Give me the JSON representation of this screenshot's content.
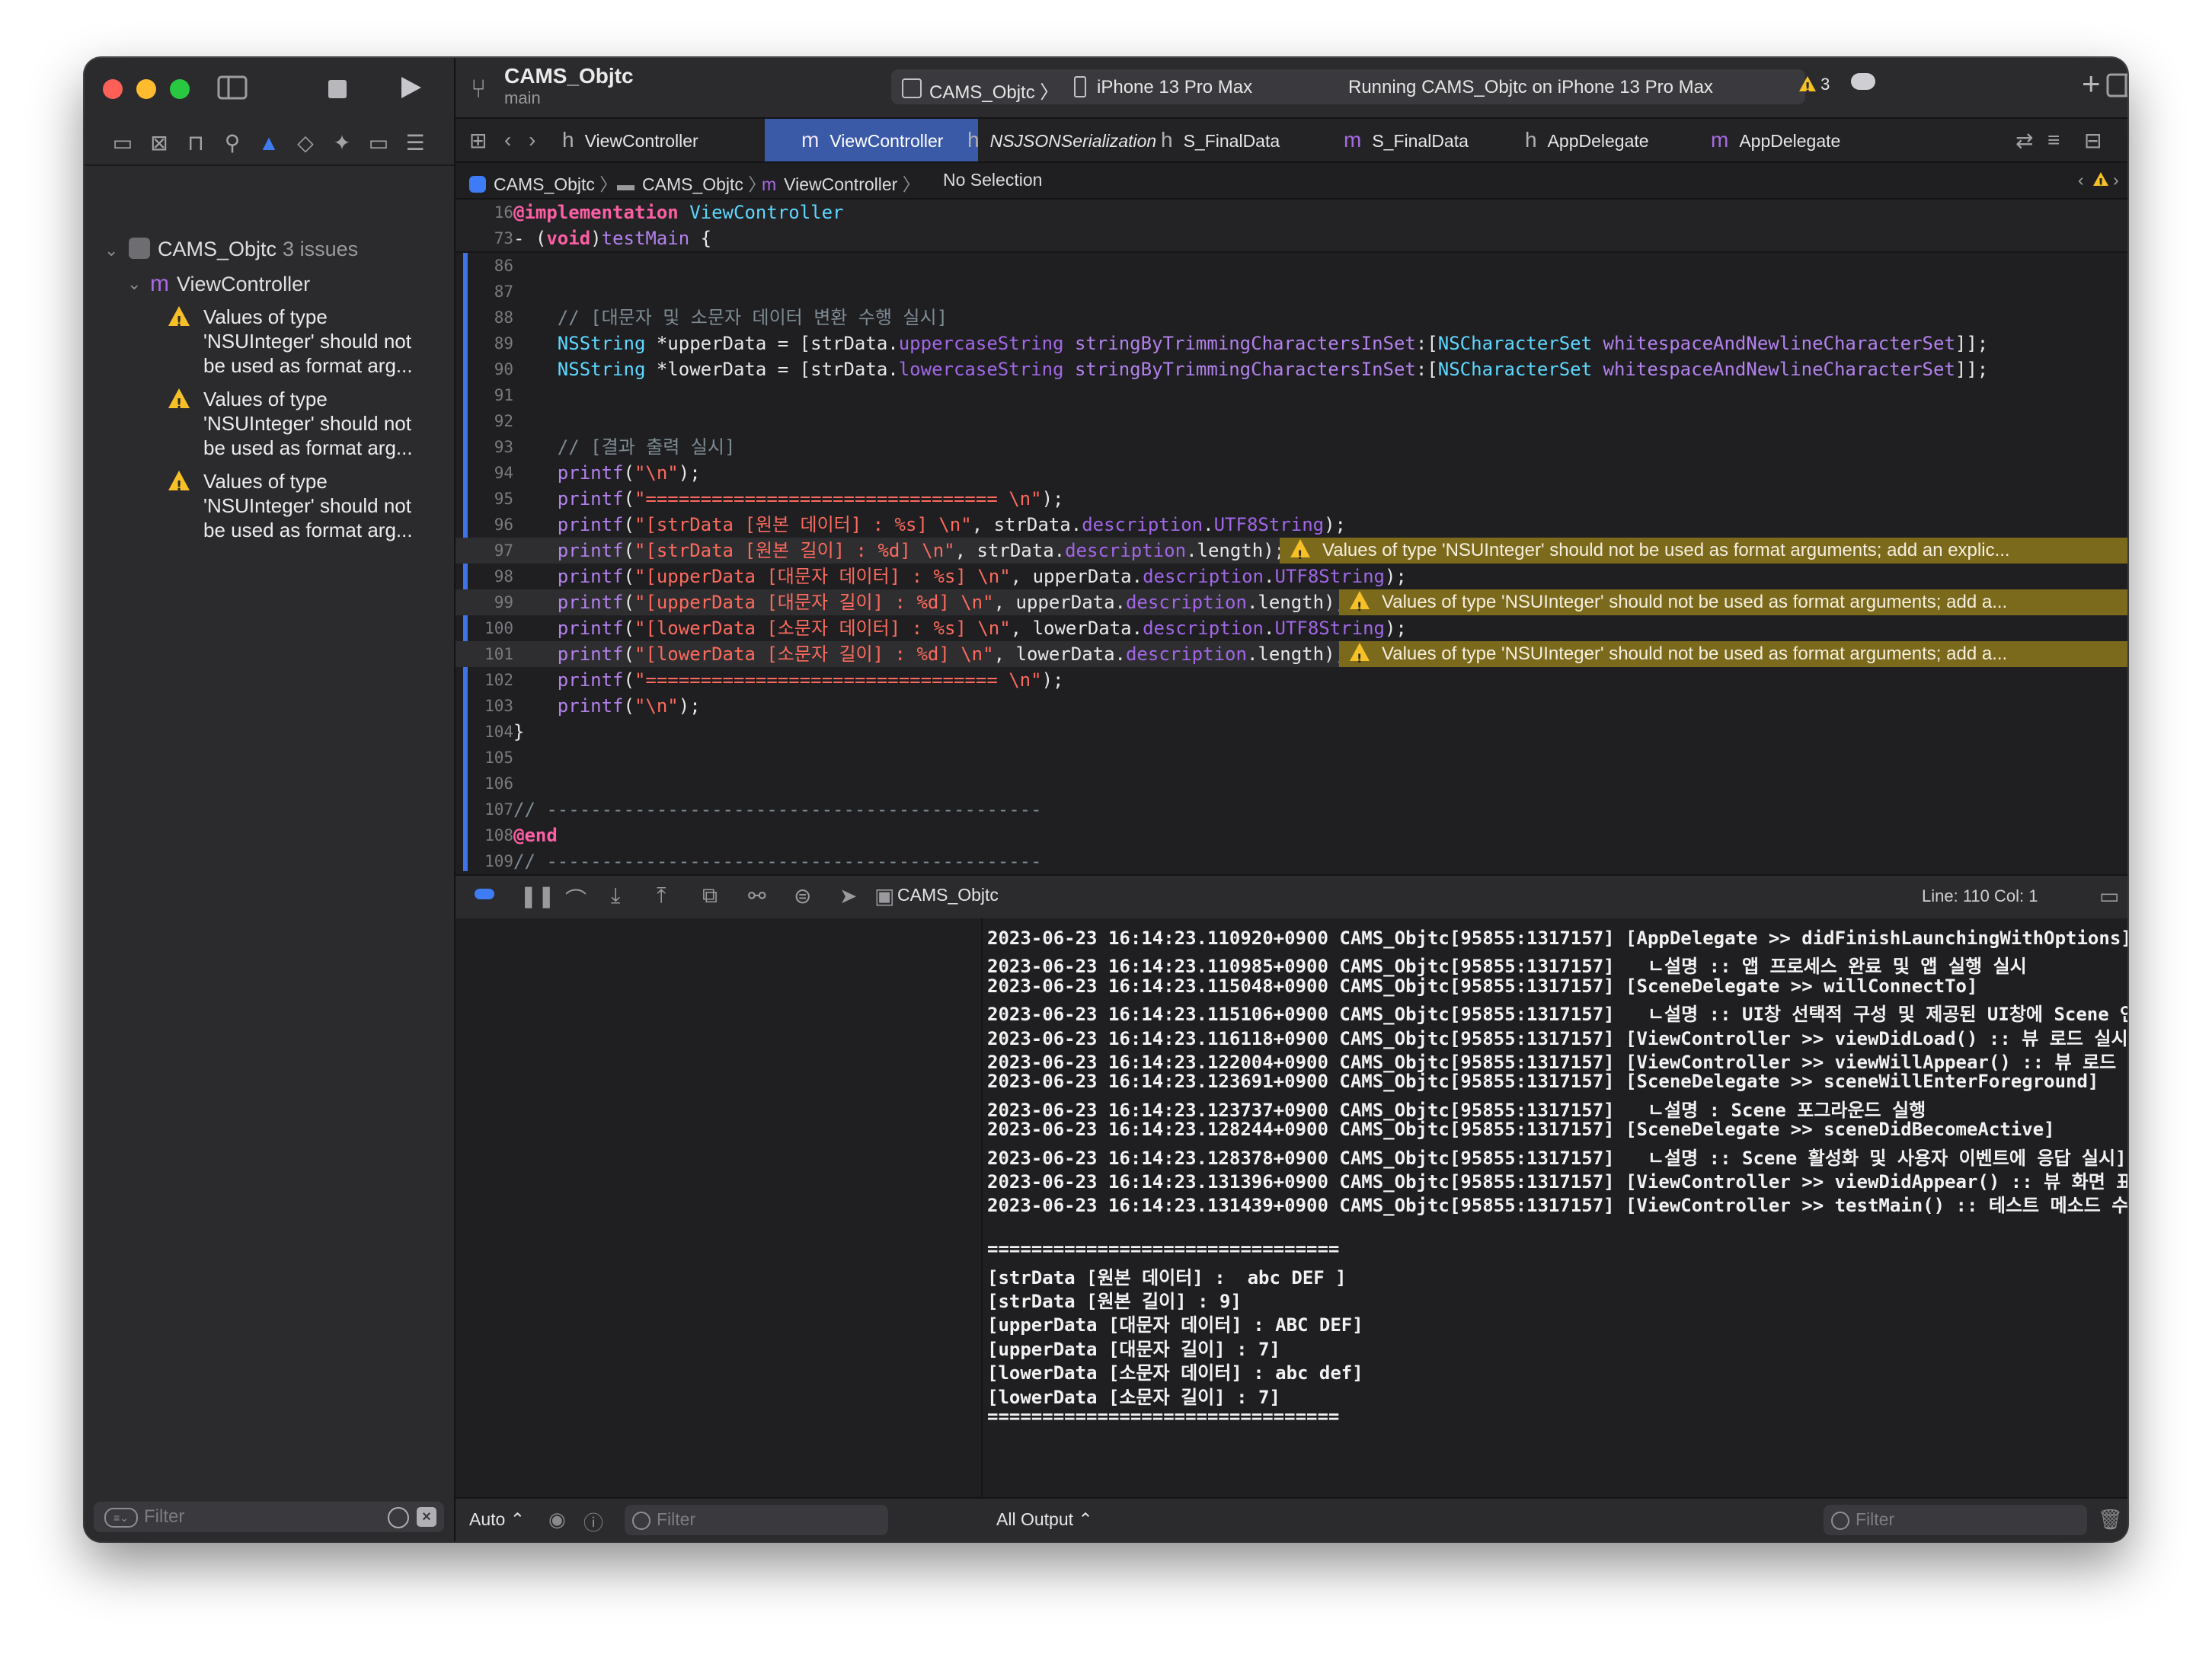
{
  "sidebar": {
    "project_name": "CAMS_Objtc",
    "project_issue_count": "3 issues",
    "file_name": "ViewController",
    "issues": [
      [
        "Values of type",
        "'NSUInteger' should not",
        "be used as format arg..."
      ],
      [
        "Values of type",
        "'NSUInteger' should not",
        "be used as format arg..."
      ],
      [
        "Values of type",
        "'NSUInteger' should not",
        "be used as format arg..."
      ]
    ],
    "filter_placeholder": "Filter"
  },
  "toolbar": {
    "scheme_title": "CAMS_Objtc",
    "scheme_branch": "main",
    "activity_target": "CAMS_Objtc",
    "activity_device": "iPhone 13 Pro Max",
    "activity_status": "Running CAMS_Objtc on iPhone 13 Pro Max",
    "warning_count": "3"
  },
  "tabs": [
    {
      "kind": "h",
      "name": "ViewController"
    },
    {
      "kind": "m",
      "name": "ViewController"
    },
    {
      "kind": "h",
      "name": "NSJSONSerialization"
    },
    {
      "kind": "h",
      "name": "S_FinalData"
    },
    {
      "kind": "m",
      "name": "S_FinalData"
    },
    {
      "kind": "h",
      "name": "AppDelegate"
    },
    {
      "kind": "m",
      "name": "AppDelegate"
    }
  ],
  "jumpbar": {
    "project": "CAMS_Objtc",
    "folder": "CAMS_Objtc",
    "file": "ViewController",
    "selection": "No Selection"
  },
  "editor": {
    "sticky": [
      {
        "ln": "16",
        "text": "@implementation ViewController"
      },
      {
        "ln": "73",
        "text": "- (void)testMain {"
      }
    ],
    "lines": [
      {
        "ln": "86",
        "text": ""
      },
      {
        "ln": "87",
        "text": ""
      },
      {
        "ln": "88",
        "text": "    // [대문자 및 소문자 데이터 변환 수행 실시]"
      },
      {
        "ln": "89",
        "text": "    NSString *upperData = [strData.uppercaseString stringByTrimmingCharactersInSet:[NSCharacterSet whitespaceAndNewlineCharacterSet]];"
      },
      {
        "ln": "90",
        "text": "    NSString *lowerData = [strData.lowercaseString stringByTrimmingCharactersInSet:[NSCharacterSet whitespaceAndNewlineCharacterSet]];"
      },
      {
        "ln": "91",
        "text": ""
      },
      {
        "ln": "92",
        "text": ""
      },
      {
        "ln": "93",
        "text": "    // [결과 출력 실시]"
      },
      {
        "ln": "94",
        "text": "    printf(\"\\n\");"
      },
      {
        "ln": "95",
        "text": "    printf(\"================================ \\n\");"
      },
      {
        "ln": "96",
        "text": "    printf(\"[strData [원본 데이터] : %s] \\n\", strData.description.UTF8String);"
      },
      {
        "ln": "97",
        "text": "    printf(\"[strData [원본 길이] : %d] \\n\", strData.description.length);"
      },
      {
        "ln": "98",
        "text": "    printf(\"[upperData [대문자 데이터] : %s] \\n\", upperData.description.UTF8String);"
      },
      {
        "ln": "99",
        "text": "    printf(\"[upperData [대문자 길이] : %d] \\n\", upperData.description.length);"
      },
      {
        "ln": "100",
        "text": "    printf(\"[lowerData [소문자 데이터] : %s] \\n\", lowerData.description.UTF8String);"
      },
      {
        "ln": "101",
        "text": "    printf(\"[lowerData [소문자 길이] : %d] \\n\", lowerData.description.length);"
      },
      {
        "ln": "102",
        "text": "    printf(\"================================ \\n\");"
      },
      {
        "ln": "103",
        "text": "    printf(\"\\n\");"
      },
      {
        "ln": "104",
        "text": "}"
      },
      {
        "ln": "105",
        "text": ""
      },
      {
        "ln": "106",
        "text": ""
      },
      {
        "ln": "107",
        "text": "// ---------------------------------------------"
      },
      {
        "ln": "108",
        "text": "@end"
      },
      {
        "ln": "109",
        "text": "// ---------------------------------------------"
      }
    ],
    "warnings": [
      {
        "ln": "97",
        "text": "Values of type 'NSUInteger' should not be used as format arguments; add an explic..."
      },
      {
        "ln": "99",
        "text": "Values of type 'NSUInteger' should not be used as format arguments; add a..."
      },
      {
        "ln": "101",
        "text": "Values of type 'NSUInteger' should not be used as format arguments; add a..."
      }
    ]
  },
  "debug": {
    "target": "CAMS_Objtc",
    "line_col": "Line: 110  Col: 1"
  },
  "console": {
    "lines": [
      "2023-06-23 16:14:23.110920+0900 CAMS_Objtc[95855:1317157] [AppDelegate >> didFinishLaunchingWithOptions]",
      "2023-06-23 16:14:23.110985+0900 CAMS_Objtc[95855:1317157]   ㄴ설명 :: 앱 프로세스 완료 및 앱 실행 실시",
      "2023-06-23 16:14:23.115048+0900 CAMS_Objtc[95855:1317157] [SceneDelegate >> willConnectTo]",
      "2023-06-23 16:14:23.115106+0900 CAMS_Objtc[95855:1317157]   ㄴ설명 :: UI창 선택적 구성 및 제공된 UI창에 Scene 연결]",
      "2023-06-23 16:14:23.116118+0900 CAMS_Objtc[95855:1317157] [ViewController >> viewDidLoad() :: 뷰 로드 실시]",
      "2023-06-23 16:14:23.122004+0900 CAMS_Objtc[95855:1317157] [ViewController >> viewWillAppear() :: 뷰 로드 완료]",
      "2023-06-23 16:14:23.123691+0900 CAMS_Objtc[95855:1317157] [SceneDelegate >> sceneWillEnterForeground]",
      "2023-06-23 16:14:23.123737+0900 CAMS_Objtc[95855:1317157]   ㄴ설명 : Scene 포그라운드 실행",
      "2023-06-23 16:14:23.128244+0900 CAMS_Objtc[95855:1317157] [SceneDelegate >> sceneDidBecomeActive]",
      "2023-06-23 16:14:23.128378+0900 CAMS_Objtc[95855:1317157]   ㄴ설명 :: Scene 활성화 및 사용자 이벤트에 응답 실시]",
      "2023-06-23 16:14:23.131396+0900 CAMS_Objtc[95855:1317157] [ViewController >> viewDidAppear() :: 뷰 화면 표시]",
      "2023-06-23 16:14:23.131439+0900 CAMS_Objtc[95855:1317157] [ViewController >> testMain() :: 테스트 메소드 수행]",
      "",
      "================================",
      "[strData [원본 데이터] :  abc DEF ]",
      "[strData [원본 길이] : 9]",
      "[upperData [대문자 데이터] : ABC DEF]",
      "[upperData [대문자 길이] : 7]",
      "[lowerData [소문자 데이터] : abc def]",
      "[lowerData [소문자 길이] : 7]",
      "================================"
    ]
  },
  "bottom": {
    "auto_label": "Auto ⌃",
    "var_filter_placeholder": "Filter",
    "output_label": "All Output ⌃",
    "console_filter_placeholder": "Filter"
  }
}
